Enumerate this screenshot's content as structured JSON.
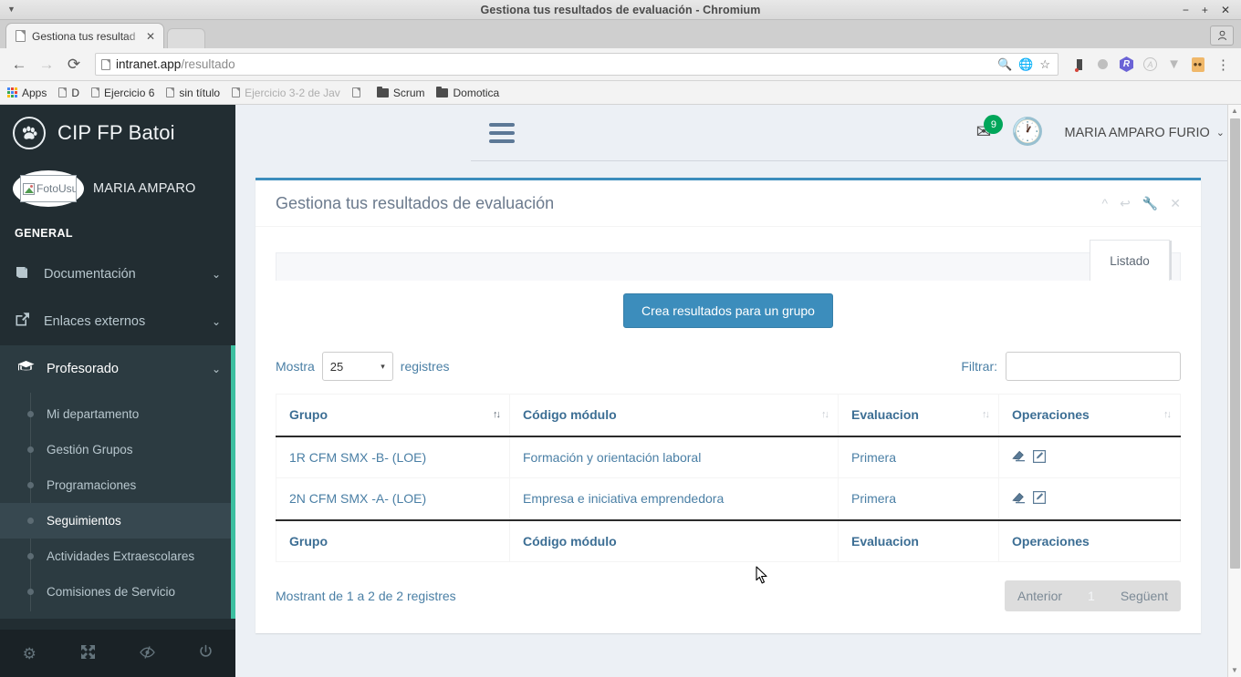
{
  "browser": {
    "window_title": "Gestiona tus resultados de evaluación - Chromium",
    "window_buttons": {
      "minimize": "−",
      "maximize": "+",
      "close": "✕"
    },
    "menu_caret": "▼",
    "tab": {
      "title": "Gestiona tus resultad",
      "close": "✕"
    },
    "nav": {
      "back": "←",
      "forward": "→",
      "reload": "⟳"
    },
    "omnibox": {
      "url_main": "intranet.app",
      "url_path": "/resultado",
      "icons": [
        "zoom-icon",
        "translate-icon",
        "star-icon"
      ]
    },
    "extensions": [
      "evernote-icon",
      "grey-dot-icon",
      "r-hex-icon",
      "angular-icon",
      "v-icon",
      "orange-box-icon"
    ],
    "menu_button": "⋮",
    "bookmarks": [
      {
        "label": "Apps",
        "icon": "apps-grid-icon"
      },
      {
        "label": "D",
        "icon": "doc-icon"
      },
      {
        "label": "Ejercicio 6",
        "icon": "doc-icon"
      },
      {
        "label": "sin título",
        "icon": "doc-icon"
      },
      {
        "label": "Ejercicio 3-2 de Jav",
        "icon": "doc-icon",
        "faded": true
      },
      {
        "label": "",
        "icon": "doc-icon"
      },
      {
        "label": "Scrum",
        "icon": "folder-icon"
      },
      {
        "label": "Domotica",
        "icon": "folder-icon"
      }
    ]
  },
  "sidebar": {
    "brand": {
      "name": "CIP FP Batoi",
      "logo_icon": "paw-print-icon"
    },
    "user": {
      "name": "MARIA AMPARO",
      "avatar_alt": "FotoUsu",
      "avatar_icon": "broken-image-icon"
    },
    "section_header": "GENERAL",
    "items": [
      {
        "label": "Documentación",
        "icon": "book-icon",
        "caret": "⌄"
      },
      {
        "label": "Enlaces externos",
        "icon": "external-link-icon",
        "caret": "⌄"
      },
      {
        "label": "Profesorado",
        "icon": "graduation-cap-icon",
        "caret": "⌄",
        "active": true
      }
    ],
    "subitems": [
      {
        "label": "Mi departamento"
      },
      {
        "label": "Gestión Grupos"
      },
      {
        "label": "Programaciones"
      },
      {
        "label": "Seguimientos",
        "active": true
      },
      {
        "label": "Actividades Extraescolares"
      },
      {
        "label": "Comisiones de Servicio"
      }
    ],
    "footer_icons": [
      "gear-icon",
      "expand-icon",
      "eye-slash-icon",
      "power-icon"
    ],
    "accent_color": "#3cbfa0",
    "bg_color": "#222d32"
  },
  "topbar": {
    "menu_toggle_icon": "hamburger-icon",
    "mail": {
      "icon": "envelope-icon",
      "badge": "9",
      "badge_color": "#00a65a"
    },
    "clock_icon": "clock-icon",
    "user_menu": {
      "label": "MARIA AMPARO FURIO",
      "caret": "⌄"
    }
  },
  "panel": {
    "title": "Gestiona tus resultados de evaluación",
    "tools": [
      "chevron-up-icon",
      "undo-icon",
      "wrench-icon",
      "close-icon"
    ],
    "accent_color": "#3c8dbc",
    "tabs": [
      {
        "label": "Listado",
        "active": true
      }
    ],
    "create_button": "Crea resultados para un grupo"
  },
  "datatable": {
    "length_label_before": "Mostra",
    "length_value": "25",
    "length_caret": "▾",
    "length_label_after": "registres",
    "filter_label": "Filtrar:",
    "filter_value": "",
    "columns": [
      "Grupo",
      "Código módulo",
      "Evaluacion",
      "Operaciones"
    ],
    "sort_icons": [
      "sort-asc-active-icon",
      "sort-icon",
      "sort-icon",
      "sort-icon"
    ],
    "rows": [
      {
        "grupo": "1R CFM SMX -B- (LOE)",
        "codigo": "Formación y orientación laboral",
        "evaluacion": "Primera",
        "ops": [
          "eraser-icon",
          "edit-icon"
        ]
      },
      {
        "grupo": "2N CFM SMX -A- (LOE)",
        "codigo": "Empresa e iniciativa emprendedora",
        "evaluacion": "Primera",
        "ops": [
          "eraser-icon",
          "edit-icon"
        ]
      }
    ],
    "info": "Mostrant de 1 a 2 de 2 registres",
    "pagination": {
      "prev": "Anterior",
      "pages": [
        "1"
      ],
      "next": "Següent",
      "current": "1"
    }
  }
}
